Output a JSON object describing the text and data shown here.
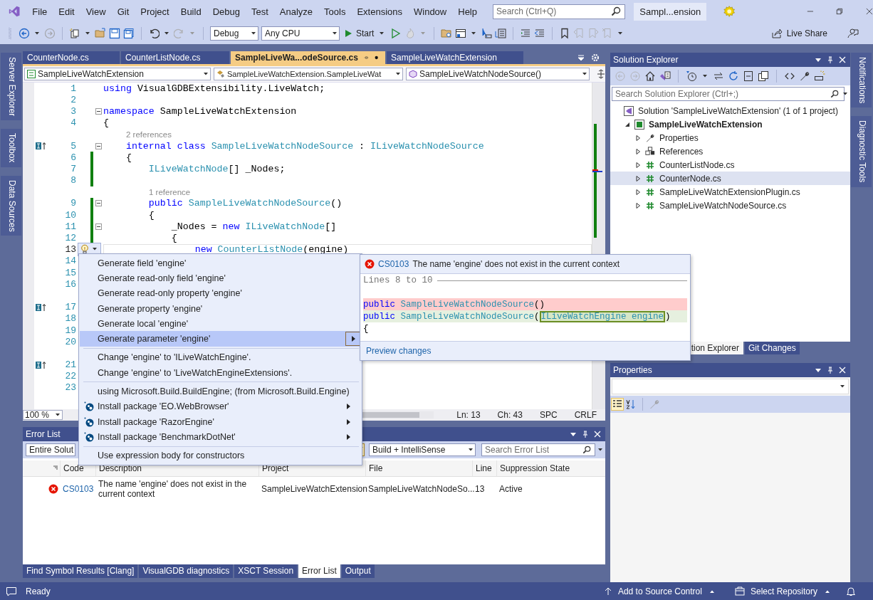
{
  "menu_bar": {
    "items": [
      "File",
      "Edit",
      "View",
      "Git",
      "Project",
      "Build",
      "Debug",
      "Test",
      "Analyze",
      "Tools",
      "Extensions",
      "Window",
      "Help"
    ],
    "search": {
      "placeholder": "Search (Ctrl+Q)"
    },
    "solution_name": "Sampl...ension"
  },
  "toolbar": {
    "configuration": "Debug",
    "platform": "Any CPU",
    "start": "Start",
    "live_share": "Live Share"
  },
  "left_strip": [
    "Server Explorer",
    "Toolbox",
    "Data Sources"
  ],
  "right_strip": [
    "Notifications",
    "Diagnostic Tools"
  ],
  "editor": {
    "tabs": [
      {
        "label": "CounterNode.cs",
        "selected": false,
        "modified": false
      },
      {
        "label": "CounterListNode.cs",
        "selected": false,
        "modified": false
      },
      {
        "label": "SampleLiveWa...odeSource.cs",
        "selected": true,
        "modified": true
      },
      {
        "label": "SampleLiveWatchExtension",
        "selected": false,
        "modified": false
      }
    ],
    "nav": [
      "SampleLiveWatchExtension",
      "SampleLiveWatchExtension.SampleLiveWat",
      "SampleLiveWatchNodeSource()"
    ],
    "lines": [
      {
        "kind": "code",
        "num": "1",
        "tokens": [
          {
            "kind": "kw",
            "text": "using"
          },
          {
            "kind": "plain",
            "text": " VisualGDBExtensibility.LiveWatch;"
          }
        ]
      },
      {
        "kind": "code",
        "num": "2"
      },
      {
        "kind": "code",
        "num": "3",
        "fold": true,
        "tokens": [
          {
            "kind": "kw",
            "text": "namespace"
          },
          {
            "kind": "plain",
            "text": " SampleLiveWatchExtension"
          }
        ]
      },
      {
        "kind": "code",
        "num": "4",
        "tokens": [
          {
            "kind": "plain",
            "text": "{"
          }
        ]
      },
      {
        "kind": "codelens",
        "text": "2 references"
      },
      {
        "kind": "code",
        "num": "5",
        "fold": true,
        "impl": true,
        "tokens": [
          {
            "kind": "kw",
            "text": "    internal"
          },
          {
            "kind": "kw",
            "text": " class"
          },
          {
            "kind": "type",
            "text": " SampleLiveWatchNodeSource"
          },
          {
            "kind": "plain",
            "text": " : "
          },
          {
            "kind": "type",
            "text": "ILiveWatchNodeSource"
          }
        ]
      },
      {
        "kind": "code",
        "num": "6",
        "changed": true,
        "tokens": [
          {
            "kind": "plain",
            "text": "    {"
          }
        ]
      },
      {
        "kind": "code",
        "num": "7",
        "changed": true,
        "tokens": [
          {
            "kind": "type",
            "text": "        ILiveWatchNode"
          },
          {
            "kind": "plain",
            "text": "[] _Nodes;"
          }
        ]
      },
      {
        "kind": "code",
        "num": "8",
        "changed": true
      },
      {
        "kind": "codelens",
        "text": "1 reference"
      },
      {
        "kind": "code",
        "num": "9",
        "fold": true,
        "changed": true,
        "tokens": [
          {
            "kind": "kw",
            "text": "        public"
          },
          {
            "kind": "type",
            "text": " SampleLiveWatchNodeSource"
          },
          {
            "kind": "plain",
            "text": "()"
          }
        ]
      },
      {
        "kind": "code",
        "num": "10",
        "changed": true,
        "tokens": [
          {
            "kind": "plain",
            "text": "        {"
          }
        ]
      },
      {
        "kind": "code",
        "num": "11",
        "fold": true,
        "changed": true,
        "tokens": [
          {
            "kind": "plain",
            "text": "            _Nodes = "
          },
          {
            "kind": "kw",
            "text": "new"
          },
          {
            "kind": "type",
            "text": " ILiveWatchNode"
          },
          {
            "kind": "plain",
            "text": "[]"
          }
        ]
      },
      {
        "kind": "code",
        "num": "12",
        "changed": true,
        "tokens": [
          {
            "kind": "plain",
            "text": "            {"
          }
        ]
      },
      {
        "kind": "code",
        "num": "13",
        "changed": true,
        "current": true,
        "tokens": [
          {
            "kind": "kw",
            "text": "                new"
          },
          {
            "kind": "type",
            "text": " CounterListNode"
          },
          {
            "kind": "plain",
            "text": "("
          },
          {
            "kind": "error",
            "text": "engine"
          },
          {
            "kind": "plain",
            "text": ")"
          }
        ]
      },
      {
        "kind": "code",
        "num": "14"
      },
      {
        "kind": "code",
        "num": "15"
      },
      {
        "kind": "code",
        "num": "16"
      },
      {
        "kind": "spacer"
      },
      {
        "kind": "code",
        "num": "17",
        "impl": true
      },
      {
        "kind": "code",
        "num": "18"
      },
      {
        "kind": "code",
        "num": "19"
      },
      {
        "kind": "code",
        "num": "20"
      },
      {
        "kind": "spacer"
      },
      {
        "kind": "code",
        "num": "21",
        "impl": true
      },
      {
        "kind": "code",
        "num": "22"
      },
      {
        "kind": "code",
        "num": "23"
      }
    ],
    "zoom": "100 %",
    "status": [
      "Ln: 13",
      "Ch: 43",
      "SPC",
      "CRLF"
    ]
  },
  "quick_actions": {
    "groups": [
      [
        {
          "label": "Generate field 'engine'",
          "kind": "action",
          "selected": false,
          "submenu": false
        },
        {
          "label": "Generate read-only field 'engine'",
          "kind": "action",
          "selected": false,
          "submenu": false
        },
        {
          "label": "Generate read-only property 'engine'",
          "kind": "action",
          "selected": false,
          "submenu": false
        },
        {
          "label": "Generate property 'engine'",
          "kind": "action",
          "selected": false,
          "submenu": false
        },
        {
          "label": "Generate local 'engine'",
          "kind": "action",
          "selected": false,
          "submenu": false
        },
        {
          "label": "Generate parameter 'engine'",
          "kind": "action",
          "selected": true,
          "submenu": true
        }
      ],
      [
        {
          "label": "Change 'engine' to 'ILiveWatchEngine'.",
          "kind": "action",
          "selected": false,
          "submenu": false
        },
        {
          "label": "Change 'engine' to 'LiveWatchEngineExtensions'.",
          "kind": "action",
          "selected": false,
          "submenu": false
        }
      ],
      [
        {
          "label": "using Microsoft.Build.BuildEngine; (from Microsoft.Build.Engine)",
          "kind": "action",
          "selected": false,
          "submenu": false
        },
        {
          "label": "Install package 'EO.WebBrowser'",
          "kind": "package",
          "selected": false,
          "submenu": true
        },
        {
          "label": "Install package 'RazorEngine'",
          "kind": "package",
          "selected": false,
          "submenu": true
        },
        {
          "label": "Install package 'BenchmarkDotNet'",
          "kind": "package",
          "selected": false,
          "submenu": true
        }
      ],
      [
        {
          "label": "Use expression body for constructors",
          "kind": "action",
          "selected": false,
          "submenu": false
        }
      ]
    ]
  },
  "preview": {
    "code": "CS0103",
    "message": "The name 'engine' does not exist in the current context",
    "range": "Lines 8 to 10",
    "lines": [
      {
        "kind": "removed",
        "tokens": [
          {
            "kind": "kw",
            "text": "public"
          },
          {
            "kind": "type",
            "text": " SampleLiveWatchNodeSource"
          },
          {
            "kind": "plain",
            "text": "()"
          }
        ]
      },
      {
        "kind": "added",
        "tokens": [
          {
            "kind": "kw",
            "text": "public"
          },
          {
            "kind": "type",
            "text": " SampleLiveWatchNodeSource"
          },
          {
            "kind": "plain",
            "text": "("
          },
          {
            "kind": "inserted",
            "text": "ILiveWatchEngine engine"
          },
          {
            "kind": "plain",
            "text": ")"
          }
        ]
      },
      {
        "kind": "context",
        "tokens": [
          {
            "kind": "plain",
            "text": "{"
          }
        ]
      }
    ],
    "link": "Preview changes"
  },
  "error_list": {
    "title": "Error List",
    "scope": "Entire Solut",
    "source": "Build + IntelliSense",
    "search": {
      "placeholder": "Search Error List"
    },
    "columns": [
      "Code",
      "Description",
      "Project",
      "File",
      "Line",
      "Suppression State"
    ],
    "rows": [
      {
        "code": "CS0103",
        "description": "The name 'engine' does not exist in the current context",
        "project": "SampleLiveWatchExtension",
        "file": "SampleLiveWatchNodeSo...",
        "line": "13",
        "state": "Active"
      }
    ]
  },
  "bottom_tabs": [
    {
      "label": "Find Symbol Results [Clang]",
      "selected": false
    },
    {
      "label": "VisualGDB diagnostics",
      "selected": false
    },
    {
      "label": "XSCT Session",
      "selected": false
    },
    {
      "label": "Error List",
      "selected": true
    },
    {
      "label": "Output",
      "selected": false
    }
  ],
  "solution_explorer": {
    "title": "Solution Explorer",
    "search": {
      "placeholder": "Search Solution Explorer (Ctrl+;)"
    },
    "tree": [
      {
        "label": "Solution 'SampleLiveWatchExtension' (1 of 1 project)",
        "kind": "solution",
        "selected": false,
        "children": [
          {
            "label": "SampleLiveWatchExtension",
            "kind": "project",
            "expanded": true,
            "selected": false,
            "children": [
              {
                "label": "Properties",
                "kind": "properties",
                "expanded": false,
                "selected": false
              },
              {
                "label": "References",
                "kind": "references",
                "expanded": false,
                "selected": false
              },
              {
                "label": "CounterListNode.cs",
                "kind": "file",
                "expanded": false,
                "selected": false
              },
              {
                "label": "CounterNode.cs",
                "kind": "file",
                "expanded": false,
                "selected": true
              },
              {
                "label": "SampleLiveWatchExtensionPlugin.cs",
                "kind": "file",
                "expanded": false,
                "selected": false
              },
              {
                "label": "SampleLiveWatchNodeSource.cs",
                "kind": "file",
                "expanded": false,
                "selected": false
              }
            ]
          }
        ]
      }
    ]
  },
  "side_tabs": [
    {
      "label": "tion Explorer",
      "selected": true
    },
    {
      "label": "Git Changes",
      "selected": false
    }
  ],
  "properties": {
    "title": "Properties"
  },
  "status_bar": {
    "text": "Ready",
    "source_control": "Add to Source Control",
    "repository": "Select Repository"
  }
}
